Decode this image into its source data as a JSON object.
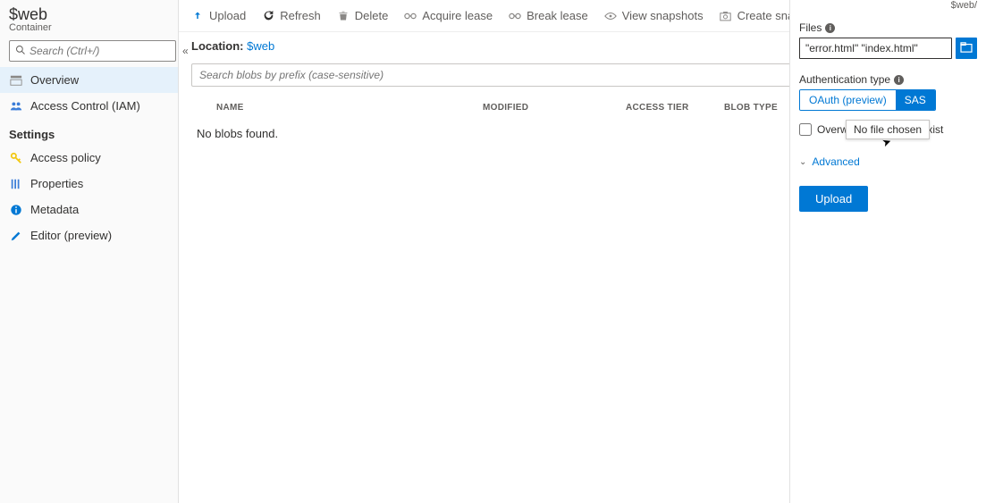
{
  "header": {
    "title": "$web",
    "subtitle": "Container",
    "search_placeholder": "Search (Ctrl+/)"
  },
  "sidebar": {
    "items": [
      {
        "label": "Overview"
      },
      {
        "label": "Access Control (IAM)"
      }
    ],
    "section_label": "Settings",
    "settings": [
      {
        "label": "Access policy"
      },
      {
        "label": "Properties"
      },
      {
        "label": "Metadata"
      },
      {
        "label": "Editor (preview)"
      }
    ]
  },
  "toolbar": {
    "upload": "Upload",
    "refresh": "Refresh",
    "delete": "Delete",
    "acquire_lease": "Acquire lease",
    "break_lease": "Break lease",
    "view_snapshots": "View snapshots",
    "create_snapshot": "Create snapshot"
  },
  "location": {
    "label": "Location:",
    "value": "$web"
  },
  "blob_search_placeholder": "Search blobs by prefix (case-sensitive)",
  "table": {
    "columns": {
      "name": "NAME",
      "modified": "MODIFIED",
      "access_tier": "ACCESS TIER",
      "blob_type": "BLOB TYPE"
    },
    "empty_message": "No blobs found."
  },
  "panel": {
    "crumb": "$web/",
    "files_label": "Files",
    "files_value": "\"error.html\" \"index.html\"",
    "auth_label": "Authentication type",
    "auth_oauth": "OAuth (preview)",
    "auth_sas": "SAS",
    "overwrite_label_left": "Overwrite",
    "overwrite_label_right": "xist",
    "tooltip": "No file chosen",
    "advanced_label": "Advanced",
    "upload_button": "Upload"
  }
}
